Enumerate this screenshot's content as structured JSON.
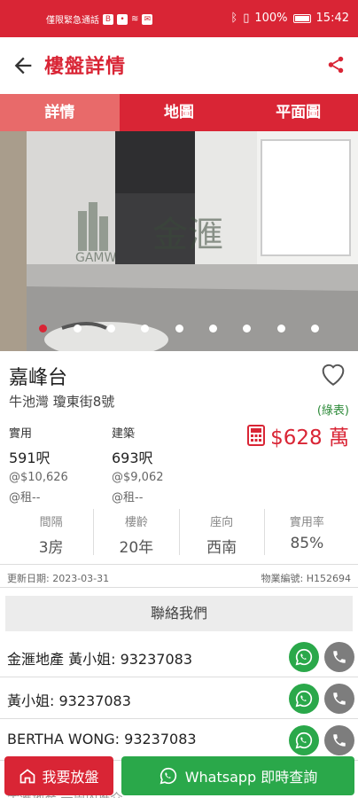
{
  "status_bar": {
    "left_text": "僅限緊急通話",
    "time": "15:42",
    "battery": "100%"
  },
  "header": {
    "title": "樓盤詳情"
  },
  "tabs": [
    {
      "label": "詳情",
      "active": true
    },
    {
      "label": "地圖",
      "active": false
    },
    {
      "label": "平面圖",
      "active": false
    }
  ],
  "gallery": {
    "watermark_text": "GAMW",
    "watermark_sub": "金滙",
    "total_dots": 9,
    "active_index": 0
  },
  "property": {
    "name": "嘉峰台",
    "address": "牛池灣 瓊東街8號",
    "price_tag": "(綠表)",
    "price": "$628 萬",
    "saleable": {
      "label": "實用",
      "area": "591呎",
      "unit_price": "@$10,626",
      "rent": "@租--"
    },
    "gross": {
      "label": "建築",
      "area": "693呎",
      "unit_price": "@$9,062",
      "rent": "@租--"
    }
  },
  "stats": [
    {
      "label": "間隔",
      "value": "3房"
    },
    {
      "label": "樓齡",
      "value": "20年"
    },
    {
      "label": "座向",
      "value": "西南"
    },
    {
      "label": "實用率",
      "value": "85%"
    }
  ],
  "meta": {
    "updated": "更新日期: 2023-03-31",
    "ref": "物業編號: H152694"
  },
  "contact": {
    "header": "聯絡我們",
    "rows": [
      {
        "text": "金滙地產 黃小姐: 93237083"
      },
      {
        "text": "黃小姐: 93237083"
      },
      {
        "text": "BERTHA WONG: 93237083"
      }
    ],
    "below_text": "金滙地產 一周內推介"
  },
  "bottom_actions": {
    "list_label": "我要放盤",
    "whatsapp_label": "Whatsapp 即時查詢"
  },
  "colors": {
    "brand_red": "#d92535",
    "whatsapp_green": "#2aa84a",
    "tag_green": "#2e8b3a"
  }
}
